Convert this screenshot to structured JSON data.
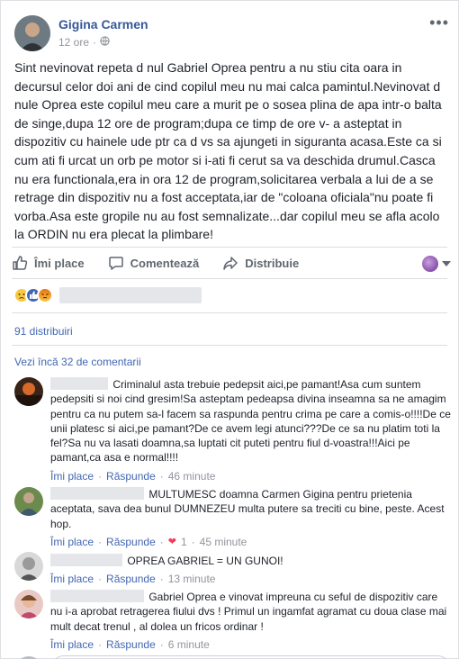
{
  "post": {
    "author": "Gigina Carmen",
    "time": "12 ore",
    "audience_icon": "globe-icon",
    "text": "Sint nevinovat repeta d nul Gabriel Oprea pentru a nu stiu cita oara in decursul celor doi ani de cind copilul meu nu mai calca pamintul.Nevinovat d nule Oprea este copilul meu care a murit pe o sosea plina de apa intr-o balta de singe,dupa 12 ore de program;dupa ce timp de ore v- a asteptat in dispozitiv cu hainele ude ptr ca d vs sa ajungeti in siguranta acasa.Este ca si cum ati fi urcat un orb pe motor si i-ati fi cerut sa va deschida drumul.Casca nu era functionala,era in ora 12 de program,solicitarea verbala a lui de a se retrage din dispozitiv nu a fost acceptata,iar de \"coloana oficiala\"nu poate fi vorba.Asa este gropile nu au fost semnalizate...dar copilul meu se afla acolo la ORDIN nu era plecat la plimbare!"
  },
  "actions": {
    "like": "Îmi place",
    "comment": "Comentează",
    "share": "Distribuie"
  },
  "stats": {
    "shares": "91 distribuiri",
    "more_comments": "Vezi încă 32 de comentarii"
  },
  "comments": [
    {
      "text": "Criminalul asta trebuie pedepsit aici,pe pamant!Asa cum suntem pedepsiti si noi cind gresim!Sa asteptam pedeapsa divina inseamna sa ne amagim pentru ca nu putem sa-l facem sa raspunda pentru crima pe care a comis-o!!!!De ce unii platesc si aici,pe pamant?De ce avem legi atunci???De ce sa nu platim toti la fel?Sa nu va lasati doamna,sa luptati cit puteti pentru fiul d-voastra!!!Aici pe pamant,ca asa e normal!!!!",
      "like": "Îmi place",
      "reply": "Răspunde",
      "time": "46 minute"
    },
    {
      "text": "MULTUMESC doamna Carmen Gigina pentru prietenia aceptata, sava dea bunul DUMNEZEU multa putere sa treciti cu bine, peste. Acest hop.",
      "like": "Îmi place",
      "reply": "Răspunde",
      "reaction_count": "1",
      "time": "45 minute"
    },
    {
      "text": "OPREA GABRIEL = UN GUNOI!",
      "like": "Îmi place",
      "reply": "Răspunde",
      "time": "13 minute"
    },
    {
      "text": "Gabriel Oprea e vinovat impreuna cu seful de dispozitiv care nu i-a aprobat retragerea fiului dvs ! Primul un ingamfat agramat cu doua clase mai mult decat trenul , al dolea un fricos ordinar !",
      "like": "Îmi place",
      "reply": "Răspunde",
      "time": "6 minute"
    }
  ],
  "colors": {
    "link": "#4267b2",
    "name": "#365899",
    "muted": "#90949c"
  }
}
